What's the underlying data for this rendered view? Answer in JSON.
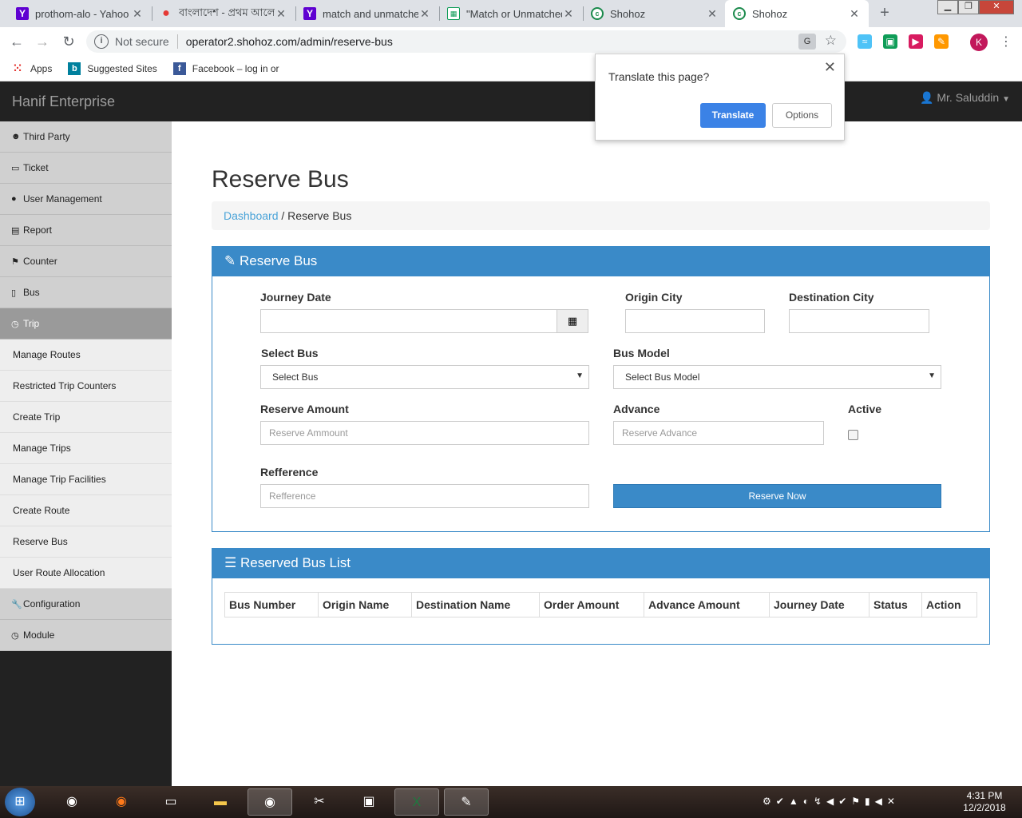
{
  "browser": {
    "tabs": [
      {
        "title": "prothom-alo - Yahoo",
        "icon": "yahoo-icon"
      },
      {
        "title": "বাংলাদেশ - প্রথম আলো",
        "icon": "prothomalo-icon"
      },
      {
        "title": "match and unmatched",
        "icon": "yahoo-icon"
      },
      {
        "title": "\"Match or Unmatched",
        "icon": "sheets-icon"
      },
      {
        "title": "Shohoz",
        "icon": "shohoz-icon"
      },
      {
        "title": "Shohoz",
        "icon": "shohoz-icon"
      }
    ],
    "not_secure": "Not secure",
    "url": "operator2.shohoz.com/admin/reserve-bus",
    "profile_initial": "K",
    "bookmarks": [
      {
        "label": "Apps",
        "icon": "apps-grid-icon"
      },
      {
        "label": "Suggested Sites",
        "icon": "bing-icon"
      },
      {
        "label": "Facebook – log in or",
        "icon": "facebook-icon"
      }
    ]
  },
  "translate_popup": {
    "question": "Translate this page?",
    "translate_label": "Translate",
    "options_label": "Options"
  },
  "app": {
    "brand": "Hanif Enterprise",
    "user": "Mr. Saluddin"
  },
  "sidebar": {
    "items": [
      {
        "label": "Third Party",
        "icon": "users-icon"
      },
      {
        "label": "Ticket",
        "icon": "ticket-icon"
      },
      {
        "label": "User Management",
        "icon": "user-icon"
      },
      {
        "label": "Report",
        "icon": "file-icon"
      },
      {
        "label": "Counter",
        "icon": "flag-icon"
      },
      {
        "label": "Bus",
        "icon": "bus-icon"
      },
      {
        "label": "Trip",
        "icon": "clock-icon"
      }
    ],
    "sub_items": [
      "Manage Routes",
      "Restricted Trip Counters",
      "Create Trip",
      "Manage Trips",
      "Manage Trip Facilities",
      "Create Route",
      "Reserve Bus",
      "User Route Allocation"
    ],
    "bottom_items": [
      {
        "label": "Configuration",
        "icon": "wrench-icon"
      },
      {
        "label": "Module",
        "icon": "clock-icon"
      }
    ]
  },
  "page": {
    "title": "Reserve Bus",
    "breadcrumb_link": "Dashboard",
    "breadcrumb_current": "/ Reserve Bus"
  },
  "form": {
    "panel_title": "Reserve Bus",
    "journey_date_label": "Journey Date",
    "origin_city_label": "Origin City",
    "destination_city_label": "Destination City",
    "select_bus_label": "Select Bus",
    "select_bus_value": "Select Bus",
    "bus_model_label": "Bus Model",
    "bus_model_value": "Select Bus Model",
    "reserve_amount_label": "Reserve Amount",
    "reserve_amount_placeholder": "Reserve Ammount",
    "advance_label": "Advance",
    "advance_placeholder": "Reserve Advance",
    "active_label": "Active",
    "reference_label": "Refference",
    "reference_placeholder": "Refference",
    "submit_label": "Reserve Now"
  },
  "list": {
    "panel_title": "Reserved Bus List",
    "columns": [
      "Bus Number",
      "Origin Name",
      "Destination Name",
      "Order Amount",
      "Advance Amount",
      "Journey Date",
      "Status",
      "Action"
    ]
  },
  "taskbar": {
    "time": "4:31 PM",
    "date": "12/2/2018"
  }
}
